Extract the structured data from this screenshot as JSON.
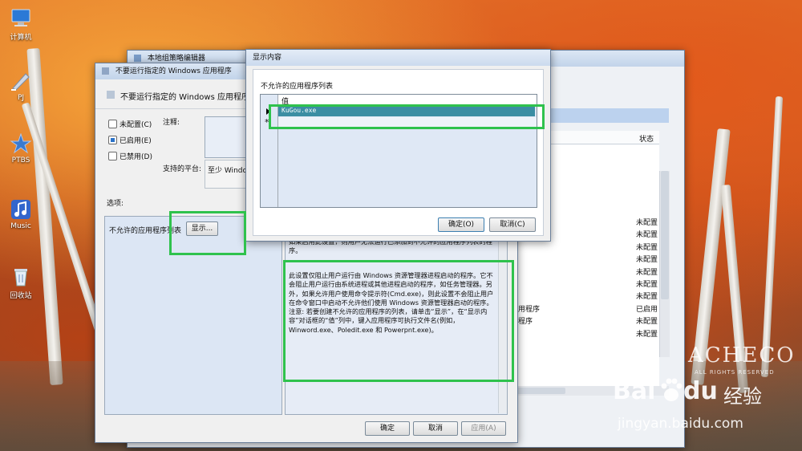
{
  "desktop_icons": [
    {
      "label": "计算机",
      "icon": "computer-icon"
    },
    {
      "label": "PJ",
      "icon": "shortcut-icon"
    },
    {
      "label": "PTBS",
      "icon": "star-icon"
    },
    {
      "label": "Music",
      "icon": "music-icon"
    },
    {
      "label": "回收站",
      "icon": "recycle-bin-icon"
    }
  ],
  "bg_window": {
    "title": "本地组策略编辑器",
    "status_header": "状态",
    "rows": [
      {
        "name": "",
        "status": "未配置"
      },
      {
        "name": "",
        "status": "未配置"
      },
      {
        "name": "",
        "status": "未配置"
      },
      {
        "name": "",
        "status": "未配置"
      },
      {
        "name": "",
        "status": "未配置"
      },
      {
        "name": "",
        "status": "未配置"
      },
      {
        "name": "",
        "status": "未配置"
      },
      {
        "name": "用程序",
        "status": "已启用"
      },
      {
        "name": "程序",
        "status": "未配置"
      },
      {
        "name": "",
        "status": "未配置"
      }
    ]
  },
  "policy_window": {
    "title": "不要运行指定的 Windows 应用程序",
    "heading": "不要运行指定的 Windows 应用程序",
    "options": {
      "not_configured": "未配置(C)",
      "enabled": "已启用(E)",
      "disabled": "已禁用(D)"
    },
    "comment_label": "注释:",
    "platform_label": "支持的平台:",
    "platform_value": "至少 Windo",
    "options_label": "选项:",
    "list_label": "不允许的应用程序列表",
    "show_button": "显示...",
    "help_top": "如果启用此设置，则用户无法运行已添加到不允许的应用程序列表的程序。",
    "help_text": "此设置仅阻止用户运行由 Windows 资源管理器进程启动的程序。它不会阻止用户运行由系统进程或其他进程启动的程序，如任务管理器。另外，如果允许用户使用命令提示符(Cmd.exe)，则此设置不会阻止用户在命令窗口中启动不允许他们使用 Windows 资源管理器启动的程序。注意: 若要创建不允许的应用程序的列表，请单击“显示”，在“显示内容”对话框的“值”列中，键入应用程序可执行文件名(例如，Winword.exe、Poledit.exe 和 Powerpnt.exe)。",
    "ok": "确定",
    "cancel": "取消",
    "apply": "应用(A)"
  },
  "show_dialog": {
    "title": "显示内容",
    "list_label": "不允许的应用程序列表",
    "column_header": "值",
    "row_value": "KuGou.exe",
    "new_row_marker": "*",
    "ok": "确定(O)",
    "cancel": "取消(C)"
  },
  "watermarks": {
    "pacheco": "ACHECO",
    "rights": "ALL RIGHTS RESERVED",
    "baidu_brand": "Bai",
    "baidu_brand2": "du",
    "baidu_cn": "经验",
    "site": "jingyan.baidu.com"
  },
  "colors": {
    "highlight": "#3b8ea3",
    "green_box": "#2fc24d"
  }
}
